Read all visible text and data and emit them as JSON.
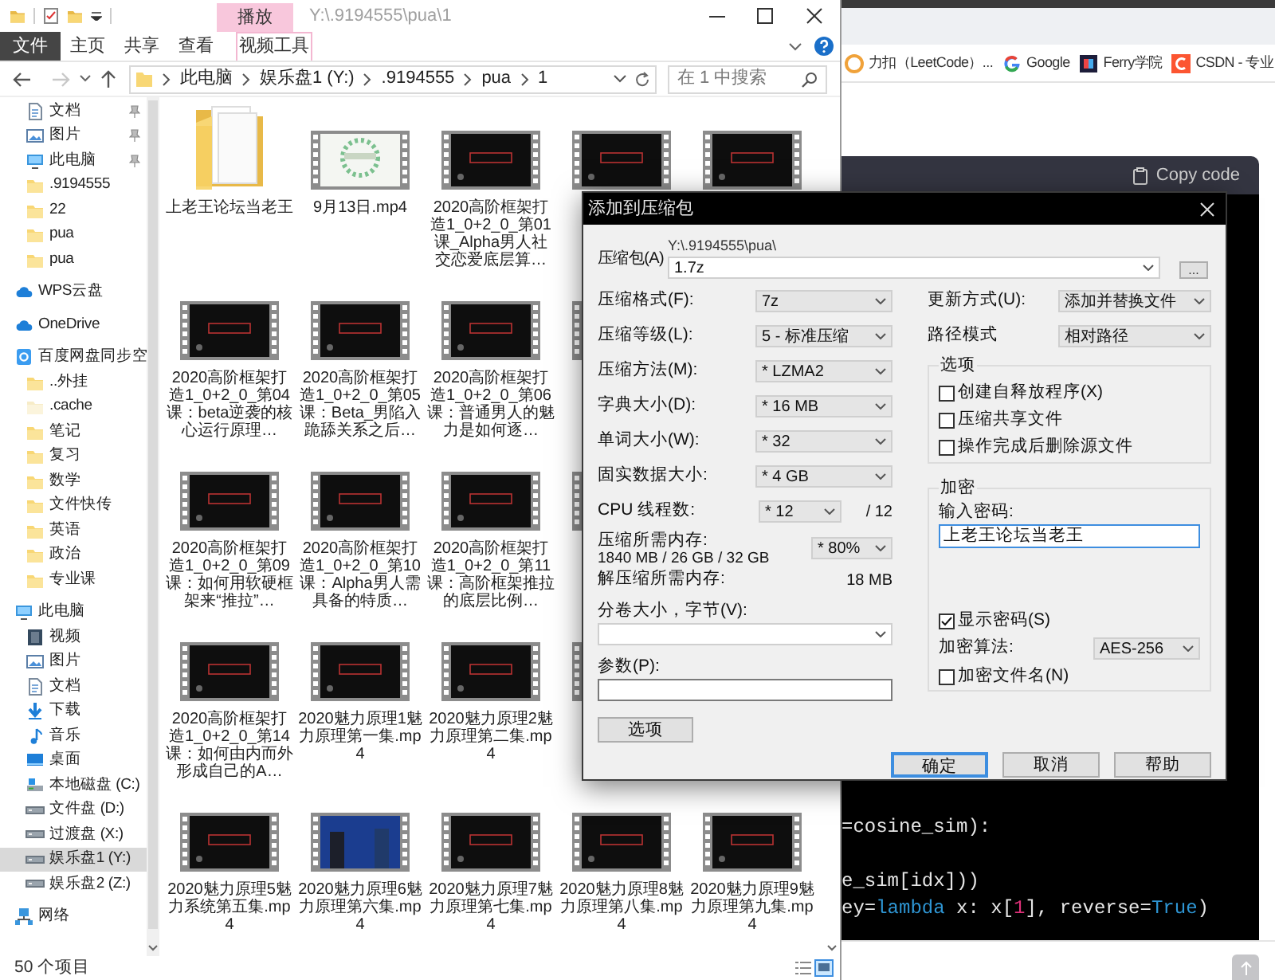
{
  "explorer": {
    "context_tab": "播放",
    "title": "Y:\\.9194555\\pua\\1",
    "ribbon_tabs": [
      {
        "label": "文件",
        "kind": "file"
      },
      {
        "label": "主页",
        "kind": "normal"
      },
      {
        "label": "共享",
        "kind": "normal"
      },
      {
        "label": "查看",
        "kind": "normal"
      },
      {
        "label": "视频工具",
        "kind": "context"
      }
    ],
    "breadcrumbs": [
      "此电脑",
      "娱乐盘1 (Y:)",
      ".9194555",
      "pua",
      "1"
    ],
    "search": {
      "placeholder": "在 1 中搜索"
    },
    "quick_access": [
      {
        "label": "文档",
        "kind": "doc",
        "pinned": true,
        "selected": false
      },
      {
        "label": "图片",
        "kind": "pic",
        "pinned": true,
        "selected": false
      },
      {
        "label": "此电脑",
        "kind": "pc",
        "pinned": true,
        "selected": false
      },
      {
        "label": ".9194555",
        "kind": "folder",
        "pinned": false,
        "selected": false
      },
      {
        "label": "22",
        "kind": "folder",
        "pinned": false,
        "selected": false
      },
      {
        "label": "pua",
        "kind": "folder",
        "pinned": false,
        "selected": false
      },
      {
        "label": "pua",
        "kind": "folder",
        "pinned": false,
        "selected": false
      }
    ],
    "nav_tree": [
      {
        "label": "WPS云盘",
        "kind": "cloud",
        "selected": false
      },
      {
        "label": "OneDrive",
        "kind": "cloud",
        "selected": false
      },
      {
        "label": "百度网盘同步空",
        "kind": "sync",
        "selected": false,
        "children": [
          {
            "label": "..外挂",
            "kind": "folder",
            "selected": false
          },
          {
            "label": ".cache",
            "kind": "hidden",
            "selected": false
          },
          {
            "label": "笔记",
            "kind": "folder",
            "selected": false
          },
          {
            "label": "复习",
            "kind": "folder",
            "selected": false
          },
          {
            "label": "数学",
            "kind": "folder",
            "selected": false
          },
          {
            "label": "文件快传",
            "kind": "folder",
            "selected": false
          },
          {
            "label": "英语",
            "kind": "folder",
            "selected": false
          },
          {
            "label": "政治",
            "kind": "folder",
            "selected": false
          },
          {
            "label": "专业课",
            "kind": "folder",
            "selected": false
          }
        ]
      },
      {
        "label": "此电脑",
        "kind": "pc",
        "selected": false,
        "children": [
          {
            "label": "视频",
            "kind": "video",
            "selected": false
          },
          {
            "label": "图片",
            "kind": "pic",
            "selected": false
          },
          {
            "label": "文档",
            "kind": "doc",
            "selected": false
          },
          {
            "label": "下载",
            "kind": "download",
            "selected": false
          },
          {
            "label": "音乐",
            "kind": "music",
            "selected": false
          },
          {
            "label": "桌面",
            "kind": "desktop",
            "selected": false
          },
          {
            "label": "本地磁盘 (C:)",
            "kind": "sysdrive",
            "selected": false
          },
          {
            "label": "文件盘 (D:)",
            "kind": "drive",
            "selected": false
          },
          {
            "label": "过渡盘 (X:)",
            "kind": "drive",
            "selected": false
          },
          {
            "label": "娱乐盘1 (Y:)",
            "kind": "drive",
            "selected": true
          },
          {
            "label": "娱乐盘2 (Z:)",
            "kind": "drive",
            "selected": false
          }
        ]
      },
      {
        "label": "网络",
        "kind": "network",
        "selected": false
      }
    ],
    "files": [
      {
        "label": "上老王论坛当老王",
        "kind": "folder"
      },
      {
        "label": "9月13日.mp4",
        "kind": "lightvideo"
      },
      {
        "label": "2020高阶框架打造1_0+2_0_第01课_Alpha男人社交恋爱底层算…",
        "kind": "video"
      },
      {
        "kind": "video"
      },
      {
        "kind": "video"
      },
      {
        "label": "2020高阶框架打造1_0+2_0_第04课：beta逆袭的核心运行原理…",
        "kind": "video"
      },
      {
        "label": "2020高阶框架打造1_0+2_0_第05课：Beta_男陷入跪舔关系之后…",
        "kind": "video"
      },
      {
        "label": "2020高阶框架打造1_0+2_0_第06课：普通男人的魅力是如何逐…",
        "kind": "video"
      },
      {
        "kind": "video"
      },
      {
        "kind": "video"
      },
      {
        "label": "2020高阶框架打造1_0+2_0_第09课：如何用软硬框架来“推拉”…",
        "kind": "video"
      },
      {
        "label": "2020高阶框架打造1_0+2_0_第10课：Alpha男人需具备的特质…",
        "kind": "video"
      },
      {
        "label": "2020高阶框架打造1_0+2_0_第11课：高阶框架推拉的底层比例…",
        "kind": "video"
      },
      {
        "kind": "video"
      },
      {
        "kind": "video"
      },
      {
        "label": "2020高阶框架打造1_0+2_0_第14课：如何由内而外形成自己的A…",
        "kind": "video"
      },
      {
        "label": "2020魅力原理1魅力原理第一集.mp4",
        "kind": "video"
      },
      {
        "label": "2020魅力原理2魅力原理第二集.mp4",
        "kind": "video"
      },
      {
        "kind": "video"
      },
      {
        "kind": "video"
      },
      {
        "label": "2020魅力原理5魅力系统第五集.mp4",
        "kind": "video"
      },
      {
        "label": "2020魅力原理6魅力原理第六集.mp4",
        "kind": "photovideo"
      },
      {
        "label": "2020魅力原理7魅力原理第七集.mp4",
        "kind": "video"
      },
      {
        "label": "2020魅力原理8魅力原理第八集.mp4",
        "kind": "video"
      },
      {
        "label": "2020魅力原理9魅力原理第九集.mp4",
        "kind": "video"
      }
    ],
    "status": "50 个项目"
  },
  "browser": {
    "bookmarks": [
      {
        "label": "力扣（LeetCode）...",
        "kind": "leetcode"
      },
      {
        "label": "Google",
        "kind": "google"
      },
      {
        "label": "Ferry学院",
        "kind": "ferry"
      },
      {
        "label": "CSDN - 专业",
        "kind": "csdn"
      }
    ],
    "copy_label": "Copy code",
    "code_lines": [
      {
        "tokens": [
          {
            "text": "=cosine_sim):",
            "color": "#e5e5e5"
          }
        ]
      },
      {
        "tokens": [
          {
            "text": "e_sim[idx]))",
            "color": "#e5e5e5"
          }
        ]
      },
      {
        "tokens": [
          {
            "text": "ey=",
            "color": "#e5e5e5"
          },
          {
            "text": "lambda",
            "color": "#2e95d3"
          },
          {
            "text": " x: x[",
            "color": "#e5e5e5"
          },
          {
            "text": "1",
            "color": "#df3079"
          },
          {
            "text": "], reverse=",
            "color": "#e5e5e5"
          },
          {
            "text": "True",
            "color": "#2e95d3"
          },
          {
            "text": ")",
            "color": "#e5e5e5"
          }
        ]
      }
    ]
  },
  "dialog": {
    "title": "添加到压缩包",
    "archive": {
      "label": "压缩包(A)",
      "path": "Y:\\.9194555\\pua\\",
      "value": "1.7z",
      "browse": "..."
    },
    "left_fields": [
      {
        "label": "压缩格式(F):",
        "value": "7z"
      },
      {
        "label": "压缩等级(L):",
        "value": "5 - 标准压缩"
      },
      {
        "label": "压缩方法(M):",
        "value": "* LZMA2"
      },
      {
        "label": "字典大小(D):",
        "value": "* 16 MB"
      },
      {
        "label": "单词大小(W):",
        "value": "* 32"
      },
      {
        "label": "固实数据大小:",
        "value": "* 4 GB"
      }
    ],
    "cpu": {
      "label": "CPU 线程数:",
      "value": "* 12",
      "total": "/ 12"
    },
    "memory": {
      "label": "压缩所需内存:",
      "detail": "1840 MB / 26 GB / 32 GB",
      "value": "* 80%"
    },
    "decompress_memory": {
      "label": "解压缩所需内存:",
      "value": "18 MB"
    },
    "volume": {
      "label": "分卷大小，字节(V):"
    },
    "params": {
      "label": "参数(P):"
    },
    "options_button": "选项",
    "right_fields": [
      {
        "label": "更新方式(U):",
        "value": "添加并替换文件"
      },
      {
        "label": "路径模式",
        "value": "相对路径"
      }
    ],
    "options_group": {
      "title": "选项",
      "checks": [
        {
          "label": "创建自释放程序(X)",
          "checked": false
        },
        {
          "label": "压缩共享文件",
          "checked": false
        },
        {
          "label": "操作完成后删除源文件",
          "checked": false
        }
      ]
    },
    "encryption": {
      "title": "加密",
      "password_label": "输入密码:",
      "password": "上老王论坛当老王",
      "show_password": {
        "label": "显示密码(S)",
        "checked": true
      },
      "method_label": "加密算法:",
      "method": "AES-256",
      "encrypt_names": {
        "label": "加密文件名(N)",
        "checked": false
      }
    },
    "buttons": [
      {
        "label": "确定",
        "default": true
      },
      {
        "label": "取消",
        "default": false
      },
      {
        "label": "帮助",
        "default": false
      }
    ]
  }
}
